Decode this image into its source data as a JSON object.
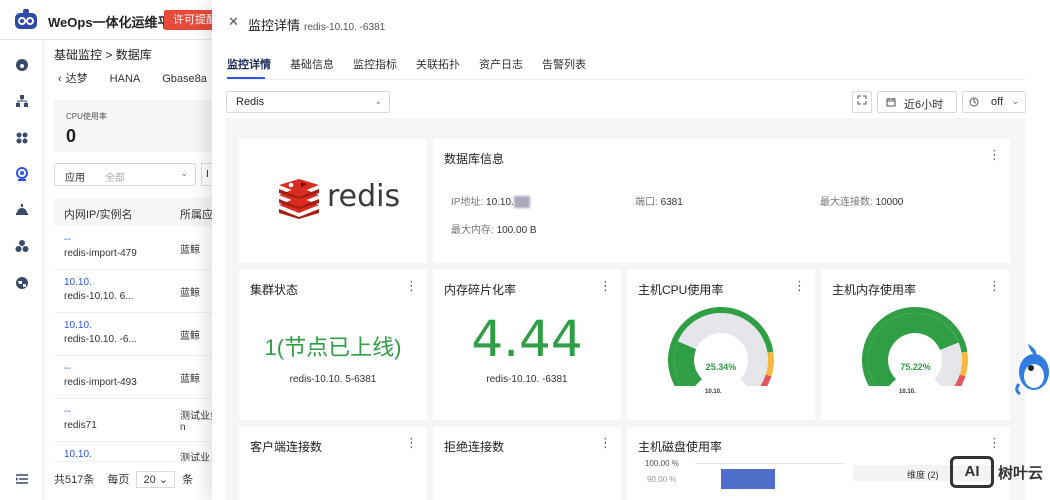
{
  "app": {
    "title": "WeOps一体化运维平台",
    "license_badge": "许可提醒"
  },
  "breadcrumb": {
    "part1": "基础监控",
    "sep": ">",
    "part2": "数据库"
  },
  "subtabs": [
    "达梦",
    "HANA",
    "Gbase8a"
  ],
  "cpu_card": {
    "label": "CPU使用率",
    "value": "0"
  },
  "filter": {
    "label": "应用",
    "value": "全部"
  },
  "table": {
    "headers": [
      "内网IP/实例名",
      "所属应用"
    ],
    "rows": [
      {
        "ip": "--",
        "name": "redis-import-479",
        "app": "蓝鲸"
      },
      {
        "ip": "10.10.",
        "name": "redis-10.10.        6...",
        "app": "蓝鲸"
      },
      {
        "ip": "10.10.",
        "name": "redis-10.10.       -6...",
        "app": "蓝鲸"
      },
      {
        "ip": "--",
        "name": "redis-import-493",
        "app": "蓝鲸"
      },
      {
        "ip": "--",
        "name": "redis71",
        "app": "测试业务\nn"
      },
      {
        "ip": "10.10.",
        "name": "",
        "app": "测试业"
      }
    ]
  },
  "pager": {
    "total": "共517条",
    "per_page_label": "每页",
    "size": "20",
    "unit": "条"
  },
  "drawer": {
    "title": "监控详情",
    "subtitle": "redis-10.10.          -6381",
    "tabs": [
      "监控详情",
      "基础信息",
      "监控指标",
      "关联拓扑",
      "资产日志",
      "告警列表"
    ],
    "resource_select": "Redis",
    "time_range": "近6小时",
    "refresh": "off"
  },
  "logo_card": {
    "text": "redis"
  },
  "db_info": {
    "title": "数据库信息",
    "ip_label": "IP地址:",
    "ip_value": "10.10.",
    "port_label": "端口:",
    "port_value": "6381",
    "maxconn_label": "最大连接数:",
    "maxconn_value": "10000",
    "maxmem_label": "最大内存:",
    "maxmem_value": "100.00 B"
  },
  "cluster": {
    "title": "集群状态",
    "status": "1(节点已上线)",
    "instance": "redis-10.10.          5-6381"
  },
  "fragmentation": {
    "title": "内存碎片化率",
    "value": "4.44",
    "instance": "redis-10.10.          -6381"
  },
  "host_cpu": {
    "title": "主机CPU使用率",
    "percent_label": "25.34%",
    "percent": 25.34,
    "instance": "10.10."
  },
  "host_mem": {
    "title": "主机内存使用率",
    "percent_label": "75.22%",
    "percent": 75.22,
    "instance": "10.10."
  },
  "client_conn": {
    "title": "客户端连接数"
  },
  "rejected_conn": {
    "title": "拒绝连接数"
  },
  "host_disk": {
    "title": "主机磁盘使用率",
    "y_top": "100.00 %",
    "y_next": "90.00 %",
    "legend": "维度 (2)"
  },
  "watermark": {
    "box": "AI",
    "text": "树叶云"
  },
  "colors": {
    "accent": "#2f54eb",
    "ok": "#2f9e44",
    "warn": "#f5b942",
    "danger": "#e8545c",
    "redis": "#d82c20"
  }
}
